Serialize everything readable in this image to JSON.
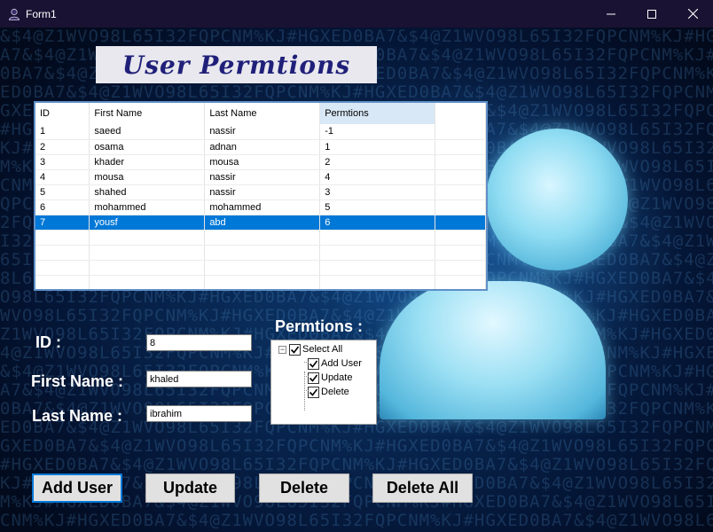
{
  "window": {
    "title": "Form1",
    "controls": {
      "minimize": "–",
      "maximize": "☐",
      "close": "✕"
    }
  },
  "heading": "User Permtions",
  "grid": {
    "columns": [
      "ID",
      "First Name",
      "Last Name",
      "Permtions"
    ],
    "rows": [
      [
        "1",
        "saeed",
        "nassir",
        "-1"
      ],
      [
        "2",
        "osama",
        "adnan",
        "1"
      ],
      [
        "3",
        "khader",
        "mousa",
        "2"
      ],
      [
        "4",
        "mousa",
        "nassir",
        "4"
      ],
      [
        "5",
        "shahed",
        "nassir",
        "3"
      ],
      [
        "6",
        "mohammed",
        "mohammed",
        "5"
      ],
      [
        "7",
        "yousf",
        "abd",
        "6"
      ]
    ],
    "selected_row": 7,
    "sorted_column": "Permtions"
  },
  "form": {
    "id_label": "ID  :",
    "id_value": "8",
    "first_name_label": "First Name :",
    "first_name_value": "khaled",
    "last_name_label": "Last Name :",
    "last_name_value": "ibrahim"
  },
  "permissions": {
    "title": "Permtions :",
    "root": {
      "label": "Select All",
      "checked": true,
      "expander": "−"
    },
    "items": [
      {
        "label": "Add User",
        "checked": true
      },
      {
        "label": "Update",
        "checked": true
      },
      {
        "label": "Delete",
        "checked": true
      }
    ]
  },
  "buttons": {
    "add_user": "Add User",
    "update": "Update",
    "delete": "Delete",
    "delete_all": "Delete All"
  },
  "colors": {
    "selection": "#0078d7",
    "heading_text": "#20207a",
    "titlebar": "#1a1233"
  }
}
